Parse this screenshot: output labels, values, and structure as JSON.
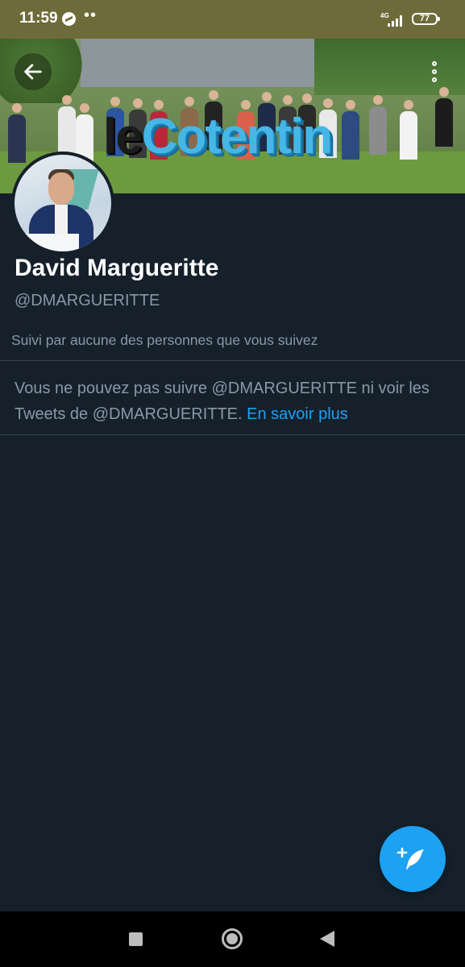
{
  "status_bar": {
    "time": "11:59",
    "dots": "••",
    "network": "4G",
    "battery": "77",
    "icons": [
      "messenger-icon",
      "signal-icon",
      "battery-icon"
    ]
  },
  "header": {
    "back_icon": "arrow-left-icon",
    "more_icon": "more-vertical-icon",
    "banner_sign": {
      "le": "le",
      "word": "Cotentin"
    }
  },
  "profile": {
    "display_name": "David Margueritte",
    "handle": "@DMARGUERITTE",
    "followed_by": "Suivi par aucune des personnes que vous suivez",
    "notice_text": "Vous ne pouvez pas suivre @DMARGUERITTE ni voir les Tweets de @DMARGUERITTE.",
    "learn_more": "En savoir plus"
  },
  "compose": {
    "icon": "compose-tweet-icon"
  },
  "nav_bar": {
    "icons": [
      "recent-apps-icon",
      "home-icon",
      "back-icon"
    ]
  },
  "colors": {
    "background": "#15202b",
    "status_bar": "#6e6b3a",
    "accent": "#1da1f2",
    "secondary_text": "#8899a6",
    "divider": "#38444d"
  }
}
